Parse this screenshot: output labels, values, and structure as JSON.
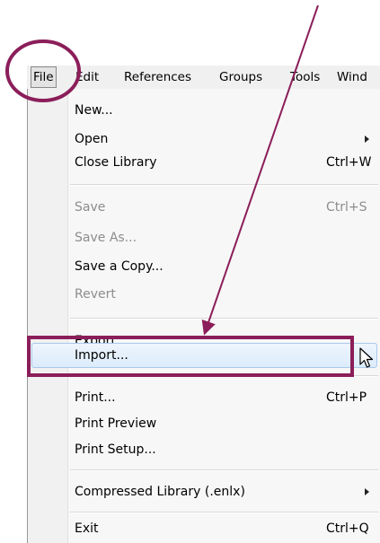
{
  "menubar": {
    "items": [
      {
        "label": "File"
      },
      {
        "label": "Edit"
      },
      {
        "label": "References"
      },
      {
        "label": "Groups"
      },
      {
        "label": "Tools"
      },
      {
        "label": "Wind"
      }
    ]
  },
  "menu": {
    "items": [
      {
        "label": "New...",
        "shortcut": "",
        "enabled": true,
        "submenu": false
      },
      {
        "label": "Open",
        "shortcut": "",
        "enabled": true,
        "submenu": true
      },
      {
        "label": "Close Library",
        "shortcut": "Ctrl+W",
        "enabled": true,
        "submenu": false
      },
      {
        "label": "Save",
        "shortcut": "Ctrl+S",
        "enabled": false,
        "submenu": false
      },
      {
        "label": "Save As...",
        "shortcut": "",
        "enabled": false,
        "submenu": false
      },
      {
        "label": "Save a Copy...",
        "shortcut": "",
        "enabled": true,
        "submenu": false
      },
      {
        "label": "Revert",
        "shortcut": "",
        "enabled": false,
        "submenu": false
      },
      {
        "label": "Export...",
        "shortcut": "",
        "enabled": true,
        "submenu": false
      },
      {
        "label": "Import...",
        "shortcut": "",
        "enabled": true,
        "submenu": false,
        "highlighted": true
      },
      {
        "label": "Print...",
        "shortcut": "Ctrl+P",
        "enabled": true,
        "submenu": false
      },
      {
        "label": "Print Preview",
        "shortcut": "",
        "enabled": true,
        "submenu": false
      },
      {
        "label": "Print Setup...",
        "shortcut": "",
        "enabled": true,
        "submenu": false
      },
      {
        "label": "Compressed Library (.enlx)",
        "shortcut": "",
        "enabled": true,
        "submenu": true
      },
      {
        "label": "Exit",
        "shortcut": "Ctrl+Q",
        "enabled": true,
        "submenu": false
      }
    ]
  },
  "annotations": {
    "color": "#8b1e5a",
    "icons": [
      "circle-annotation-file",
      "rectangle-annotation-import",
      "arrow-annotation"
    ]
  }
}
